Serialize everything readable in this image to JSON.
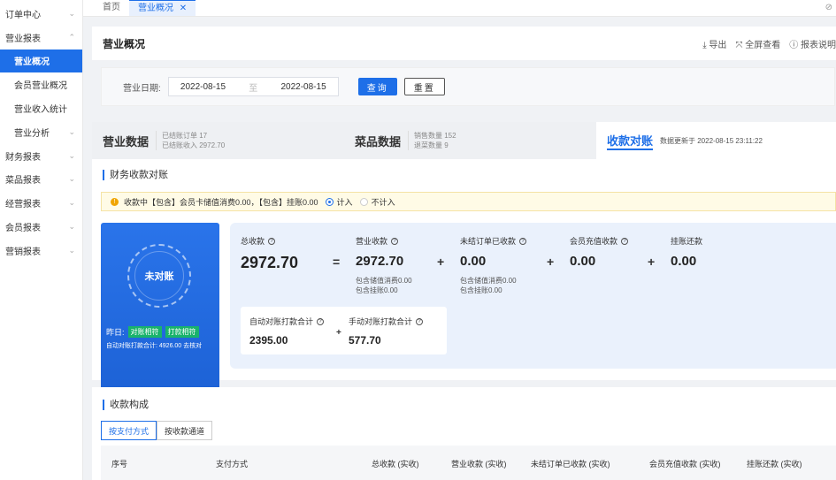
{
  "sidebar": {
    "items": [
      {
        "label": "订单中心",
        "chev": "⌄"
      },
      {
        "label": "营业报表",
        "chev": "⌃"
      },
      {
        "label": "营业概况",
        "active": true
      },
      {
        "label": "会员营业概况"
      },
      {
        "label": "营业收入统计"
      },
      {
        "label": "营业分析",
        "chev": "⌄"
      },
      {
        "label": "财务报表",
        "chev": "⌄"
      },
      {
        "label": "菜品报表",
        "chev": "⌄"
      },
      {
        "label": "经营报表",
        "chev": "⌄"
      },
      {
        "label": "会员报表",
        "chev": "⌄"
      },
      {
        "label": "营销报表",
        "chev": "⌄"
      }
    ]
  },
  "tabs": {
    "home": "首页",
    "active": "营业概况",
    "close": "✕"
  },
  "header": {
    "title": "营业概况",
    "export": "⤓ 导出",
    "fullscreen": "⤧ 全屏查看",
    "help": "ⓘ 报表说明"
  },
  "filter": {
    "label": "营业日期:",
    "start": "2022-08-15",
    "sep": "至",
    "end": "2022-08-15",
    "query": "查询",
    "reset": "重置"
  },
  "summary": {
    "biz_title": "营业数据",
    "biz_line1": "已结账订单 17",
    "biz_line2": "已结账收入 2972.70",
    "dish_title": "菜品数据",
    "dish_line1": "销售数量 152",
    "dish_line2": "退菜数量 9",
    "recon_title": "收款对账",
    "updated": "数据更新于 2022-08-15 23:11:22"
  },
  "recon": {
    "section_title": "财务收款对账",
    "notice_text": "收款中【包含】会员卡储值消费0.00，【包含】挂账0.00",
    "notice_icon": "!",
    "opt_in": "计入",
    "opt_out": "不计入",
    "status": "未对账",
    "yesterday": "昨日:",
    "tag1": "对账相符",
    "tag2": "打款相符",
    "auto_total": "自动对账打款合计: 4926.00  去核对",
    "total_label": "总收款",
    "total_value": "2972.70",
    "eq": "=",
    "biz_label": "营业收款",
    "biz_value": "2972.70",
    "biz_sub1": "包含储值消费0.00",
    "biz_sub2": "包含挂账0.00",
    "plus": "+",
    "unsettled_label": "未结订单已收款",
    "unsettled_value": "0.00",
    "unsettled_sub1": "包含储值消费0.00",
    "unsettled_sub2": "包含挂账0.00",
    "member_label": "会员充值收款",
    "member_value": "0.00",
    "credit_label": "挂账还款",
    "credit_value": "0.00",
    "auto_label": "自动对账打款合计",
    "auto_value": "2395.00",
    "manual_label": "手动对账打款合计",
    "manual_value": "577.70",
    "small_plus": "+"
  },
  "composition": {
    "title": "收款构成",
    "tab1": "按支付方式",
    "tab2": "按收款通道",
    "columns": [
      "序号",
      "支付方式",
      "总收款 (实收)",
      "营业收款 (实收)",
      "未结订单已收款 (实收)",
      "会员充值收款 (实收)",
      "挂账还款 (实收)"
    ]
  },
  "colors": {
    "accent": "#1e6fe8",
    "green": "#19b36b",
    "warning": "#f0a500"
  }
}
